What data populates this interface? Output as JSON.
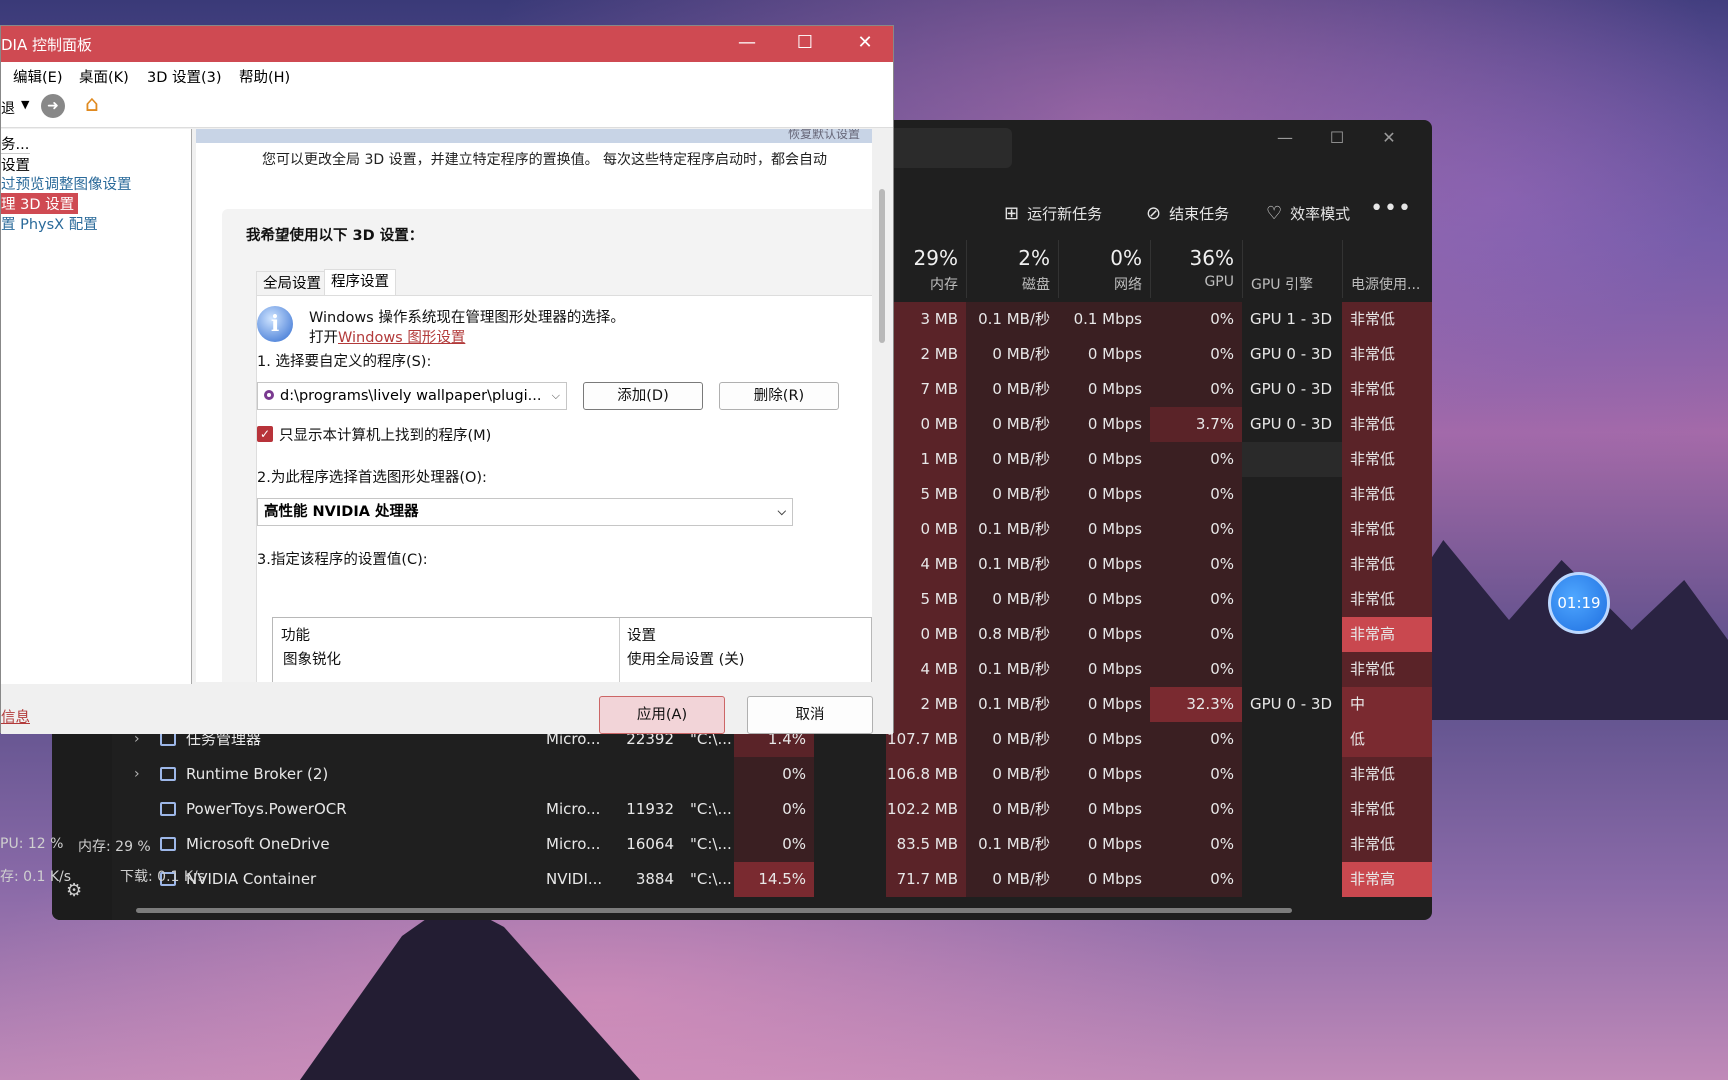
{
  "task_manager": {
    "commands": {
      "run_new_task": "运行新任务",
      "end_task": "结束任务",
      "efficiency_mode": "效率模式",
      "more": "•••"
    },
    "columns": [
      {
        "pct": "29%",
        "label": "内存"
      },
      {
        "pct": "2%",
        "label": "磁盘"
      },
      {
        "pct": "0%",
        "label": "网络"
      },
      {
        "pct": "36%",
        "label": "GPU"
      },
      {
        "pct": "",
        "label": "GPU 引擎"
      },
      {
        "pct": "",
        "label": "电源使用..."
      },
      {
        "pct": "",
        "label": "电源"
      }
    ],
    "rows_partial": [
      {
        "mem": "3 MB",
        "disk": "0.1 MB/秒",
        "net": "0.1 Mbps",
        "gpu": "0%",
        "engine": "GPU 1 - 3D",
        "power": "非常低"
      },
      {
        "mem": "2 MB",
        "disk": "0 MB/秒",
        "net": "0 Mbps",
        "gpu": "0%",
        "engine": "GPU 0 - 3D",
        "power": "非常低"
      },
      {
        "mem": "7 MB",
        "disk": "0 MB/秒",
        "net": "0 Mbps",
        "gpu": "0%",
        "engine": "GPU 0 - 3D",
        "power": "非常低"
      },
      {
        "mem": "0 MB",
        "disk": "0 MB/秒",
        "net": "0 Mbps",
        "gpu": "3.7%",
        "engine": "GPU 0 - 3D",
        "power": "非常低"
      },
      {
        "mem": "1 MB",
        "disk": "0 MB/秒",
        "net": "0 Mbps",
        "gpu": "0%",
        "engine": "",
        "power": "非常低"
      },
      {
        "mem": "5 MB",
        "disk": "0 MB/秒",
        "net": "0 Mbps",
        "gpu": "0%",
        "engine": "",
        "power": "非常低"
      },
      {
        "mem": "0 MB",
        "disk": "0.1 MB/秒",
        "net": "0 Mbps",
        "gpu": "0%",
        "engine": "",
        "power": "非常低"
      },
      {
        "mem": "4 MB",
        "disk": "0.1 MB/秒",
        "net": "0 Mbps",
        "gpu": "0%",
        "engine": "",
        "power": "非常低"
      },
      {
        "mem": "5 MB",
        "disk": "0 MB/秒",
        "net": "0 Mbps",
        "gpu": "0%",
        "engine": "",
        "power": "非常低"
      },
      {
        "mem": "0 MB",
        "disk": "0.8 MB/秒",
        "net": "0 Mbps",
        "gpu": "0%",
        "engine": "",
        "power": "非常高"
      },
      {
        "mem": "4 MB",
        "disk": "0.1 MB/秒",
        "net": "0 Mbps",
        "gpu": "0%",
        "engine": "",
        "power": "非常低"
      },
      {
        "mem": "2 MB",
        "disk": "0.1 MB/秒",
        "net": "0 Mbps",
        "gpu": "32.3%",
        "engine": "GPU 0 - 3D",
        "power": "中"
      }
    ],
    "rows_full": [
      {
        "name": "任务管理器",
        "publisher": "Micro...",
        "pid": "",
        "cmd": "\"C:\\...",
        "cpu": "1.4%",
        "mem": "107.7 MB",
        "disk": "0 MB/秒",
        "net": "0 Mbps",
        "gpu": "0%",
        "engine": "",
        "power": "低"
      },
      {
        "name": "Runtime Broker (2)",
        "publisher": "",
        "pid": "",
        "cmd": "",
        "cpu": "0%",
        "mem": "106.8 MB",
        "disk": "0 MB/秒",
        "net": "0 Mbps",
        "gpu": "0%",
        "engine": "",
        "power": "非常低"
      },
      {
        "name": "PowerToys.PowerOCR",
        "publisher": "Micro...",
        "pid": "11932",
        "cmd": "\"C:\\...",
        "cpu": "0%",
        "mem": "102.2 MB",
        "disk": "0 MB/秒",
        "net": "0 Mbps",
        "gpu": "0%",
        "engine": "",
        "power": "非常低"
      },
      {
        "name": "Microsoft OneDrive",
        "publisher": "Micro...",
        "pid": "16064",
        "cmd": "\"C:\\...",
        "cpu": "0%",
        "mem": "83.5 MB",
        "disk": "0.1 MB/秒",
        "net": "0 Mbps",
        "gpu": "0%",
        "engine": "",
        "power": "非常低"
      },
      {
        "name": "NVIDIA Container",
        "publisher": "NVIDI...",
        "pid": "3884",
        "cmd": "\"C:\\...",
        "cpu": "14.5%",
        "mem": "71.7 MB",
        "disk": "0 MB/秒",
        "net": "0 Mbps",
        "gpu": "0%",
        "engine": "",
        "power": "非常高"
      }
    ],
    "pid_first": "22392"
  },
  "nvidia": {
    "title": "DIA 控制面板",
    "menu": [
      "编辑(E)",
      "桌面(K)",
      "3D 设置(3)",
      "帮助(H)"
    ],
    "toolbar_partial": "退",
    "left_tree": [
      "务...",
      "设置",
      "过预览调整图像设置",
      "理 3D 设置",
      "置 PhysX 配置"
    ],
    "left_link": "信息",
    "banner": "恢复默认设置",
    "description": "您可以更改全局 3D 设置，并建立特定程序的置换值。 每次这些特定程序启动时，都会自动",
    "box_title": "我希望使用以下 3D 设置：",
    "tabs": [
      "全局设置",
      "程序设置"
    ],
    "info_line1": "Windows 操作系统现在管理图形处理器的选择。",
    "info_line2_prefix": "打开",
    "info_link": "Windows 图形设置",
    "step1": "1. 选择要自定义的程序(S):",
    "program_value": "d:\\programs\\lively wallpaper\\plugi...",
    "add_button": "添加(D)",
    "remove_button": "删除(R)",
    "checkbox_label": "只显示本计算机上找到的程序(M)",
    "step2": "2.为此程序选择首选图形处理器(O):",
    "gpu_value": "高性能 NVIDIA 处理器",
    "step3": "3.指定该程序的设置值(C):",
    "table_headers": [
      "功能",
      "设置"
    ],
    "table_rows": [
      [
        "图象锐化",
        "使用全局设置 (关)"
      ]
    ],
    "apply_button": "应用(A)",
    "cancel_button": "取消"
  },
  "overlay": {
    "cpu": "PU: 12 %",
    "mem": "内存: 29 %",
    "up": "存: 0.1 K/s",
    "down": "下载: 0.1 K/s"
  },
  "timer": "01:19"
}
